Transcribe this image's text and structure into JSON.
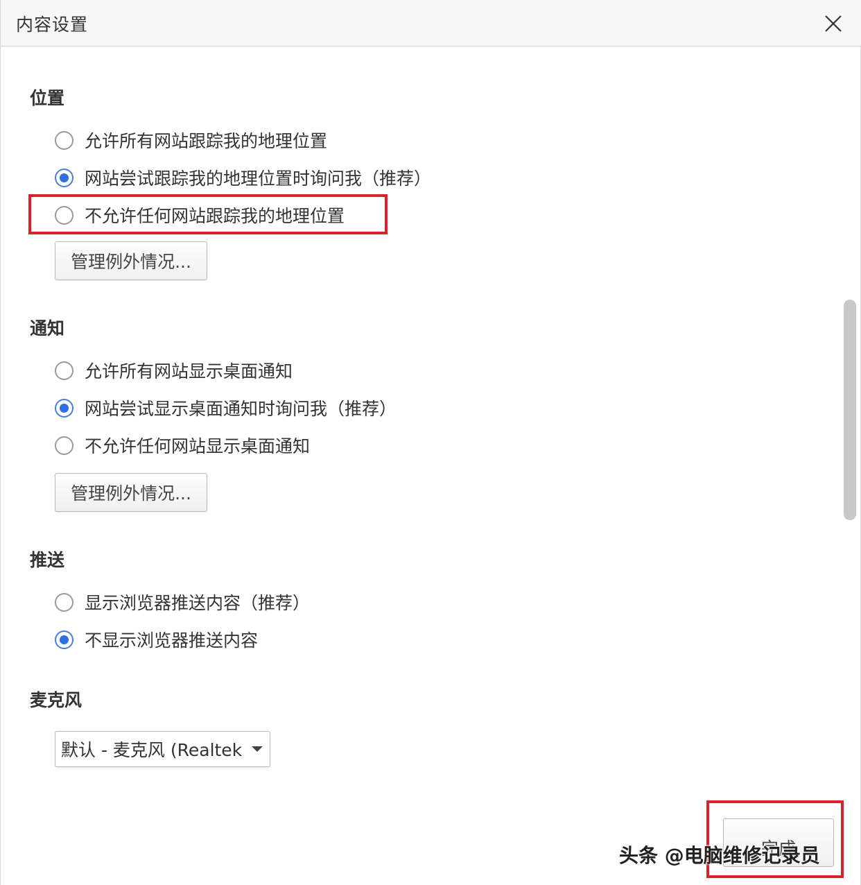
{
  "window": {
    "title": "内容设置"
  },
  "location": {
    "title": "位置",
    "options": [
      {
        "label": "允许所有网站跟踪我的地理位置",
        "checked": false
      },
      {
        "label": "网站尝试跟踪我的地理位置时询问我（推荐）",
        "checked": true
      },
      {
        "label": "不允许任何网站跟踪我的地理位置",
        "checked": false
      }
    ],
    "manage_button": "管理例外情况..."
  },
  "notifications": {
    "title": "通知",
    "options": [
      {
        "label": "允许所有网站显示桌面通知",
        "checked": false
      },
      {
        "label": "网站尝试显示桌面通知时询问我（推荐）",
        "checked": true
      },
      {
        "label": "不允许任何网站显示桌面通知",
        "checked": false
      }
    ],
    "manage_button": "管理例外情况..."
  },
  "push": {
    "title": "推送",
    "options": [
      {
        "label": "显示浏览器推送内容（推荐）",
        "checked": false
      },
      {
        "label": "不显示浏览器推送内容",
        "checked": true
      }
    ]
  },
  "microphone": {
    "title": "麦克风",
    "selected": "默认 - 麦克风 (Realtek"
  },
  "footer": {
    "done_button": "完成"
  },
  "watermark": "头条 @电脑维修记录员",
  "colors": {
    "highlight": "#d9222a",
    "radio_checked": "#2f6fe0"
  }
}
